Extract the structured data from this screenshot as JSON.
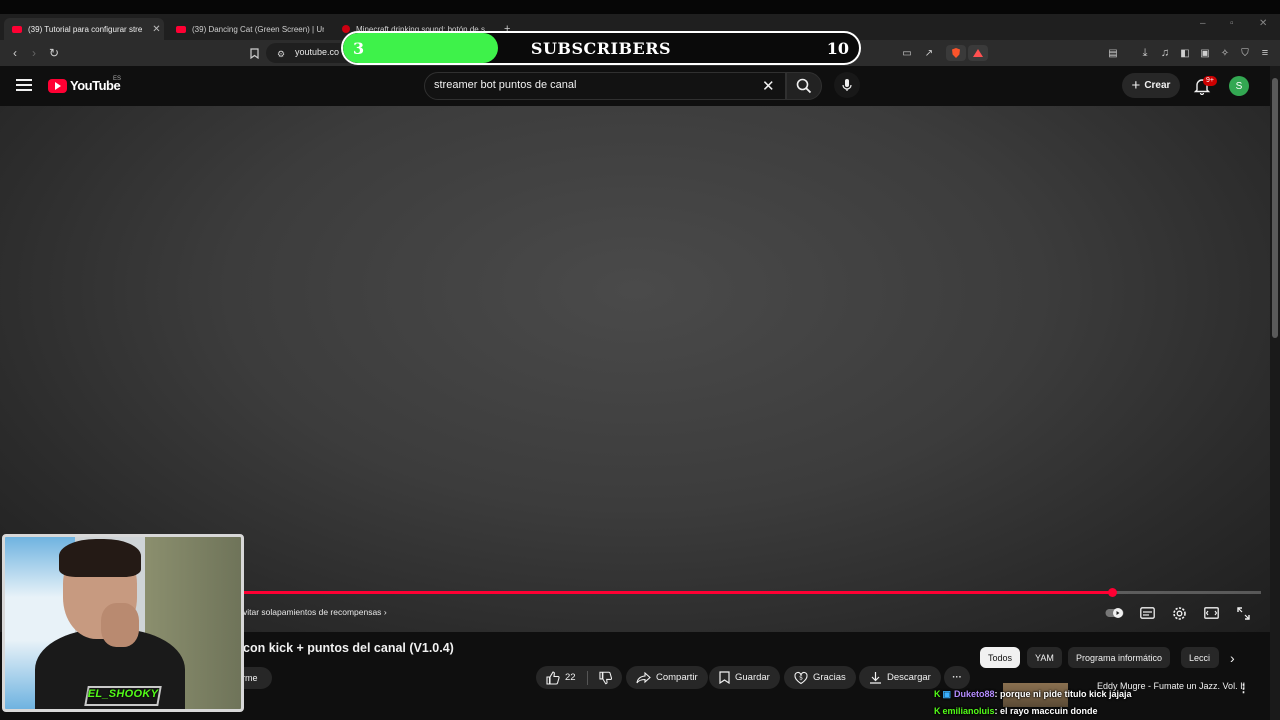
{
  "browser": {
    "tabs": [
      {
        "label": "(39) Tutorial para configurar stre"
      },
      {
        "label": "(39) Dancing Cat (Green Screen) | Un"
      },
      {
        "label": "Minecraft drinking sound: botón de s"
      }
    ],
    "new_tab": "+",
    "url": "youtube.co"
  },
  "subscribers_overlay": {
    "current": "3",
    "label": "SUBSCRIBERS",
    "goal": "10",
    "progress": 0.3,
    "fill_color": "#3ef24a"
  },
  "youtube": {
    "logo_text": "YouTube",
    "region": "ES",
    "search_query": "streamer bot puntos de canal",
    "create_label": "Crear",
    "notification_badge": "9+",
    "avatar_letter": "S"
  },
  "player": {
    "chapter_label": "vitar solapamientos de recompensas",
    "progress": 0.854,
    "accent_color": "#ff0033"
  },
  "video": {
    "title": "con kick + puntos del canal (V1.0.4)",
    "join_label": "rme",
    "likes": "22",
    "share_label": "Compartir",
    "save_label": "Guardar",
    "thanks_label": "Gracias",
    "download_label": "Descargar"
  },
  "chips": [
    "Todos",
    "YAM",
    "Programa informático",
    "Lecci"
  ],
  "recommendation": {
    "title": "Eddy Mugre - Fumate un Jazz. Vol. II"
  },
  "chat": [
    {
      "user": "Duketo88",
      "message": ": porque ni pide titulo kick jajaja"
    },
    {
      "user": "emilianoluis",
      "message": ": el rayo maccuin donde"
    }
  ],
  "webcam": {
    "name": "EL_SHOOKY"
  }
}
